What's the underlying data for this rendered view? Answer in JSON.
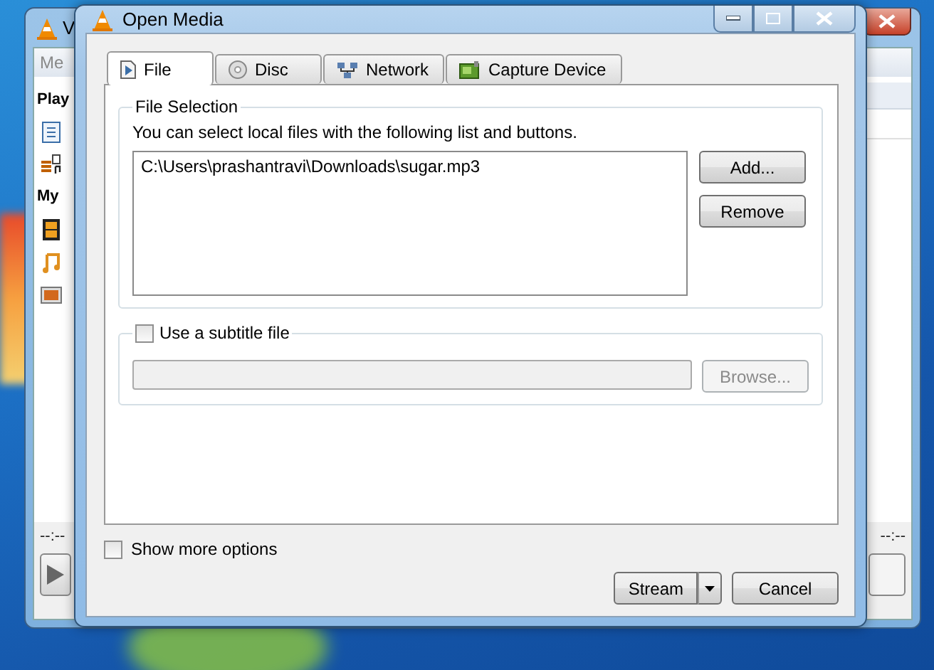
{
  "background_window": {
    "title": "V",
    "menu": [
      "Me"
    ],
    "sidebar": [
      {
        "kind": "header",
        "label": "Play"
      },
      {
        "kind": "item"
      },
      {
        "kind": "item"
      },
      {
        "kind": "header",
        "label": "My"
      },
      {
        "kind": "item"
      },
      {
        "kind": "item"
      },
      {
        "kind": "item"
      }
    ],
    "elapsed": "--:--",
    "total": "--:--"
  },
  "dialog": {
    "title": "Open Media",
    "tabs": [
      {
        "label": "File",
        "selected": true
      },
      {
        "label": "Disc",
        "selected": false
      },
      {
        "label": "Network",
        "selected": false
      },
      {
        "label": "Capture Device",
        "selected": false
      }
    ],
    "file_selection": {
      "title": "File Selection",
      "description": "You can select local files with the following list and buttons.",
      "files": [
        "C:\\Users\\prashantravi\\Downloads\\sugar.mp3"
      ],
      "buttons": [
        "Add...",
        "Remove"
      ]
    },
    "subtitle": {
      "label": "Use a subtitle file",
      "checked": false,
      "button": "Browse...",
      "disabled": true
    },
    "show_more_options": {
      "label": "Show more options",
      "checked": false
    },
    "buttons": [
      {
        "kind": "split",
        "label": "Stream"
      },
      {
        "kind": "plain",
        "label": "Cancel"
      }
    ]
  }
}
